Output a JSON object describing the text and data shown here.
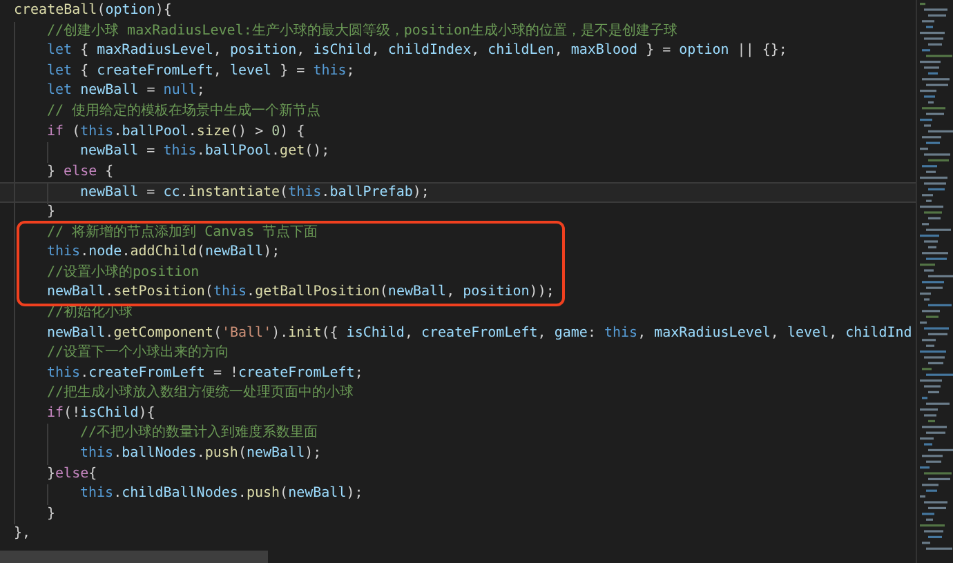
{
  "editor": {
    "lines": [
      {
        "current": false,
        "boxed": false,
        "tokens": [
          {
            "text": "createBall",
            "kind": "fn"
          },
          {
            "text": "(",
            "kind": "p"
          },
          {
            "text": "option",
            "kind": "var"
          },
          {
            "text": "){",
            "kind": "p"
          }
        ],
        "children": [
          {
            "current": false,
            "boxed": false,
            "tokens": [
              {
                "text": "//创建小球 maxRadiusLevel:生产小球的最大圆等级，position生成小球的位置，是不是创建子球",
                "kind": "cm"
              }
            ]
          },
          {
            "current": false,
            "boxed": false,
            "tokens": [
              {
                "text": "let",
                "kind": "kw"
              },
              {
                "text": " { ",
                "kind": "p"
              },
              {
                "text": "maxRadiusLevel",
                "kind": "var"
              },
              {
                "text": ", ",
                "kind": "p"
              },
              {
                "text": "position",
                "kind": "var"
              },
              {
                "text": ", ",
                "kind": "p"
              },
              {
                "text": "isChild",
                "kind": "var"
              },
              {
                "text": ", ",
                "kind": "p"
              },
              {
                "text": "childIndex",
                "kind": "var"
              },
              {
                "text": ", ",
                "kind": "p"
              },
              {
                "text": "childLen",
                "kind": "var"
              },
              {
                "text": ", ",
                "kind": "p"
              },
              {
                "text": "maxBlood",
                "kind": "var"
              },
              {
                "text": " } = ",
                "kind": "p"
              },
              {
                "text": "option",
                "kind": "var"
              },
              {
                "text": " || {};",
                "kind": "p"
              }
            ]
          },
          {
            "current": false,
            "boxed": false,
            "tokens": [
              {
                "text": "let",
                "kind": "kw"
              },
              {
                "text": " { ",
                "kind": "p"
              },
              {
                "text": "createFromLeft",
                "kind": "var"
              },
              {
                "text": ", ",
                "kind": "p"
              },
              {
                "text": "level",
                "kind": "var"
              },
              {
                "text": " } = ",
                "kind": "p"
              },
              {
                "text": "this",
                "kind": "kw"
              },
              {
                "text": ";",
                "kind": "p"
              }
            ]
          },
          {
            "current": false,
            "boxed": false,
            "tokens": [
              {
                "text": "let",
                "kind": "kw"
              },
              {
                "text": " newBall",
                "kind": "var"
              },
              {
                "text": " = ",
                "kind": "p"
              },
              {
                "text": "null",
                "kind": "kw"
              },
              {
                "text": ";",
                "kind": "p"
              }
            ]
          },
          {
            "current": false,
            "boxed": false,
            "tokens": [
              {
                "text": "// 使用给定的模板在场景中生成一个新节点",
                "kind": "cm"
              }
            ]
          },
          {
            "current": false,
            "boxed": false,
            "tokens": [
              {
                "text": "if",
                "kind": "ctl"
              },
              {
                "text": " (",
                "kind": "p"
              },
              {
                "text": "this",
                "kind": "kw"
              },
              {
                "text": ".",
                "kind": "p"
              },
              {
                "text": "ballPool",
                "kind": "var"
              },
              {
                "text": ".",
                "kind": "p"
              },
              {
                "text": "size",
                "kind": "fn"
              },
              {
                "text": "() > ",
                "kind": "p"
              },
              {
                "text": "0",
                "kind": "num"
              },
              {
                "text": ") {",
                "kind": "p"
              }
            ],
            "children": [
              {
                "current": false,
                "boxed": false,
                "tokens": [
                  {
                    "text": "newBall",
                    "kind": "var"
                  },
                  {
                    "text": " = ",
                    "kind": "p"
                  },
                  {
                    "text": "this",
                    "kind": "kw"
                  },
                  {
                    "text": ".",
                    "kind": "p"
                  },
                  {
                    "text": "ballPool",
                    "kind": "var"
                  },
                  {
                    "text": ".",
                    "kind": "p"
                  },
                  {
                    "text": "get",
                    "kind": "fn"
                  },
                  {
                    "text": "();",
                    "kind": "p"
                  }
                ]
              }
            ]
          },
          {
            "current": false,
            "boxed": false,
            "tokens": [
              {
                "text": "} ",
                "kind": "p"
              },
              {
                "text": "else",
                "kind": "ctl"
              },
              {
                "text": " {",
                "kind": "p"
              }
            ],
            "children": [
              {
                "current": true,
                "boxed": false,
                "tokens": [
                  {
                    "text": "newBall",
                    "kind": "var"
                  },
                  {
                    "text": " = ",
                    "kind": "p"
                  },
                  {
                    "text": "cc",
                    "kind": "var"
                  },
                  {
                    "text": ".",
                    "kind": "p"
                  },
                  {
                    "text": "instantiate",
                    "kind": "fn"
                  },
                  {
                    "text": "(",
                    "kind": "p"
                  },
                  {
                    "text": "this",
                    "kind": "kw"
                  },
                  {
                    "text": ".",
                    "kind": "p"
                  },
                  {
                    "text": "ballPrefab",
                    "kind": "var"
                  },
                  {
                    "text": ");",
                    "kind": "p"
                  }
                ]
              }
            ]
          },
          {
            "current": false,
            "boxed": false,
            "tokens": [
              {
                "text": "}",
                "kind": "p"
              }
            ]
          },
          {
            "current": false,
            "boxed": true,
            "tokens": [
              {
                "text": "// 将新增的节点添加到 Canvas 节点下面",
                "kind": "cm"
              }
            ]
          },
          {
            "current": false,
            "boxed": true,
            "tokens": [
              {
                "text": "this",
                "kind": "kw"
              },
              {
                "text": ".",
                "kind": "p"
              },
              {
                "text": "node",
                "kind": "var"
              },
              {
                "text": ".",
                "kind": "p"
              },
              {
                "text": "addChild",
                "kind": "fn"
              },
              {
                "text": "(",
                "kind": "p"
              },
              {
                "text": "newBall",
                "kind": "var"
              },
              {
                "text": ");",
                "kind": "p"
              }
            ]
          },
          {
            "current": false,
            "boxed": true,
            "tokens": [
              {
                "text": "//设置小球的position",
                "kind": "cm"
              }
            ]
          },
          {
            "current": false,
            "boxed": true,
            "tokens": [
              {
                "text": "newBall",
                "kind": "var"
              },
              {
                "text": ".",
                "kind": "p"
              },
              {
                "text": "setPosition",
                "kind": "fn"
              },
              {
                "text": "(",
                "kind": "p"
              },
              {
                "text": "this",
                "kind": "kw"
              },
              {
                "text": ".",
                "kind": "p"
              },
              {
                "text": "getBallPosition",
                "kind": "fn"
              },
              {
                "text": "(",
                "kind": "p"
              },
              {
                "text": "newBall",
                "kind": "var"
              },
              {
                "text": ", ",
                "kind": "p"
              },
              {
                "text": "position",
                "kind": "var"
              },
              {
                "text": "));",
                "kind": "p"
              }
            ]
          },
          {
            "current": false,
            "boxed": false,
            "tokens": [
              {
                "text": "//初始化小球",
                "kind": "cm"
              }
            ]
          },
          {
            "current": false,
            "boxed": false,
            "tokens": [
              {
                "text": "newBall",
                "kind": "var"
              },
              {
                "text": ".",
                "kind": "p"
              },
              {
                "text": "getComponent",
                "kind": "fn"
              },
              {
                "text": "(",
                "kind": "p"
              },
              {
                "text": "'Ball'",
                "kind": "str"
              },
              {
                "text": ").",
                "kind": "p"
              },
              {
                "text": "init",
                "kind": "fn"
              },
              {
                "text": "({ ",
                "kind": "p"
              },
              {
                "text": "isChild",
                "kind": "var"
              },
              {
                "text": ", ",
                "kind": "p"
              },
              {
                "text": "createFromLeft",
                "kind": "var"
              },
              {
                "text": ", ",
                "kind": "p"
              },
              {
                "text": "game",
                "kind": "var"
              },
              {
                "text": ": ",
                "kind": "p"
              },
              {
                "text": "this",
                "kind": "kw"
              },
              {
                "text": ", ",
                "kind": "p"
              },
              {
                "text": "maxRadiusLevel",
                "kind": "var"
              },
              {
                "text": ", ",
                "kind": "p"
              },
              {
                "text": "level",
                "kind": "var"
              },
              {
                "text": ", ",
                "kind": "p"
              },
              {
                "text": "childInd",
                "kind": "var"
              }
            ]
          },
          {
            "current": false,
            "boxed": false,
            "tokens": [
              {
                "text": "//设置下一个小球出来的方向",
                "kind": "cm"
              }
            ]
          },
          {
            "current": false,
            "boxed": false,
            "tokens": [
              {
                "text": "this",
                "kind": "kw"
              },
              {
                "text": ".",
                "kind": "p"
              },
              {
                "text": "createFromLeft",
                "kind": "var"
              },
              {
                "text": " = !",
                "kind": "p"
              },
              {
                "text": "createFromLeft",
                "kind": "var"
              },
              {
                "text": ";",
                "kind": "p"
              }
            ]
          },
          {
            "current": false,
            "boxed": false,
            "tokens": [
              {
                "text": "//把生成小球放入数组方便统一处理页面中的小球",
                "kind": "cm"
              }
            ]
          },
          {
            "current": false,
            "boxed": false,
            "tokens": [
              {
                "text": "if",
                "kind": "ctl"
              },
              {
                "text": "(!",
                "kind": "p"
              },
              {
                "text": "isChild",
                "kind": "var"
              },
              {
                "text": "){",
                "kind": "p"
              }
            ],
            "children": [
              {
                "current": false,
                "boxed": false,
                "tokens": [
                  {
                    "text": "//不把小球的数量计入到难度系数里面",
                    "kind": "cm"
                  }
                ]
              },
              {
                "current": false,
                "boxed": false,
                "tokens": [
                  {
                    "text": "this",
                    "kind": "kw"
                  },
                  {
                    "text": ".",
                    "kind": "p"
                  },
                  {
                    "text": "ballNodes",
                    "kind": "var"
                  },
                  {
                    "text": ".",
                    "kind": "p"
                  },
                  {
                    "text": "push",
                    "kind": "fn"
                  },
                  {
                    "text": "(",
                    "kind": "p"
                  },
                  {
                    "text": "newBall",
                    "kind": "var"
                  },
                  {
                    "text": ");",
                    "kind": "p"
                  }
                ]
              }
            ]
          },
          {
            "current": false,
            "boxed": false,
            "tokens": [
              {
                "text": "}",
                "kind": "p"
              },
              {
                "text": "else",
                "kind": "ctl"
              },
              {
                "text": "{",
                "kind": "p"
              }
            ],
            "children": [
              {
                "current": false,
                "boxed": false,
                "tokens": [
                  {
                    "text": "this",
                    "kind": "kw"
                  },
                  {
                    "text": ".",
                    "kind": "p"
                  },
                  {
                    "text": "childBallNodes",
                    "kind": "var"
                  },
                  {
                    "text": ".",
                    "kind": "p"
                  },
                  {
                    "text": "push",
                    "kind": "fn"
                  },
                  {
                    "text": "(",
                    "kind": "p"
                  },
                  {
                    "text": "newBall",
                    "kind": "var"
                  },
                  {
                    "text": ");",
                    "kind": "p"
                  }
                ]
              }
            ]
          },
          {
            "current": false,
            "boxed": false,
            "tokens": [
              {
                "text": "}",
                "kind": "p"
              }
            ]
          }
        ]
      },
      {
        "current": false,
        "boxed": false,
        "tokens": [
          {
            "text": "},",
            "kind": "p"
          }
        ]
      }
    ]
  }
}
